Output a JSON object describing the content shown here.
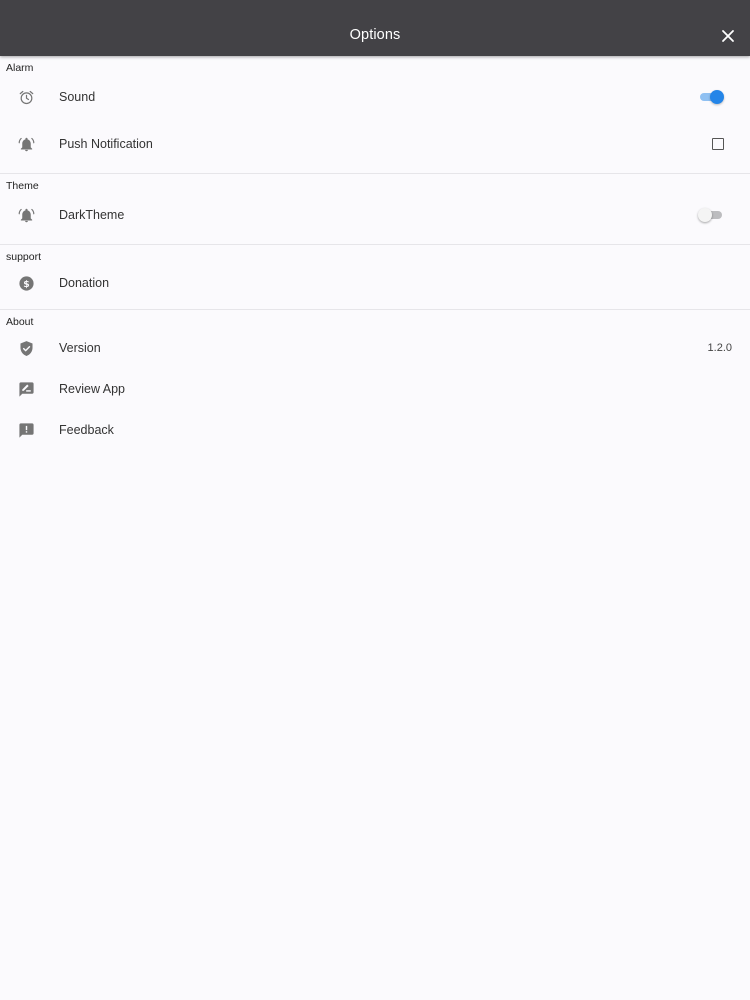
{
  "header": {
    "title": "Options"
  },
  "sections": {
    "alarm": {
      "label": "Alarm",
      "sound": {
        "label": "Sound",
        "enabled": true
      },
      "push_notification": {
        "label": "Push Notification",
        "checked": false
      }
    },
    "theme": {
      "label": "Theme",
      "dark_theme": {
        "label": "DarkTheme",
        "enabled": false
      }
    },
    "support": {
      "label": "support",
      "donation": {
        "label": "Donation"
      }
    },
    "about": {
      "label": "About",
      "version": {
        "label": "Version",
        "value": "1.2.0"
      },
      "review_app": {
        "label": "Review App"
      },
      "feedback": {
        "label": "Feedback"
      }
    }
  },
  "icons": {
    "close": "close-icon",
    "sound": "alarm-clock-icon",
    "push_notification": "bell-ring-icon",
    "dark_theme": "bell-ring-icon",
    "donation": "dollar-circle-icon",
    "version": "shield-check-icon",
    "review_app": "rate-review-icon",
    "feedback": "feedback-icon"
  },
  "colors": {
    "header_bg": "#434246",
    "page_bg": "#fbfafd",
    "accent": "#2485e8",
    "icon": "#757575"
  }
}
